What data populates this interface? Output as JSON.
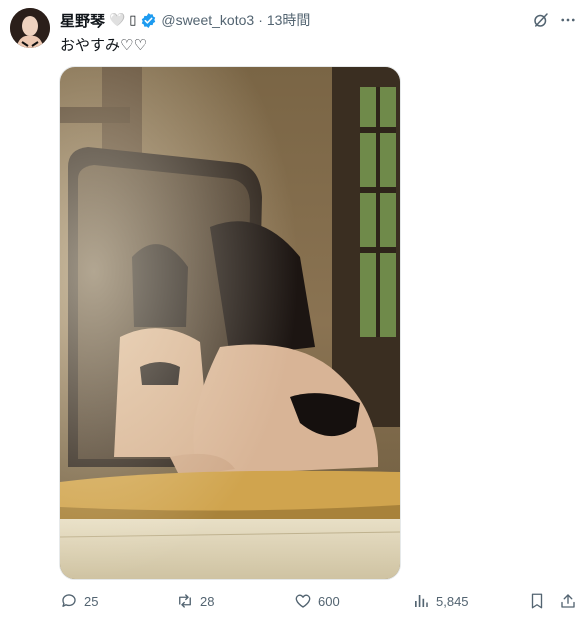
{
  "tweet": {
    "display_name": "星野琴",
    "name_emoji": "🤍",
    "name_extra": "▯",
    "handle": "@sweet_koto3",
    "separator": "·",
    "time": "13時間",
    "text": "おやすみ♡♡"
  },
  "actions": {
    "replies": "25",
    "retweets": "28",
    "likes": "600",
    "views": "5,845"
  },
  "colors": {
    "verified": "#1d9bf0",
    "muted": "#536471"
  },
  "icons": [
    "avatar",
    "verified-badge-icon",
    "grok-icon",
    "more-icon",
    "reply-icon",
    "retweet-icon",
    "like-icon",
    "views-icon",
    "bookmark-icon",
    "share-icon"
  ]
}
